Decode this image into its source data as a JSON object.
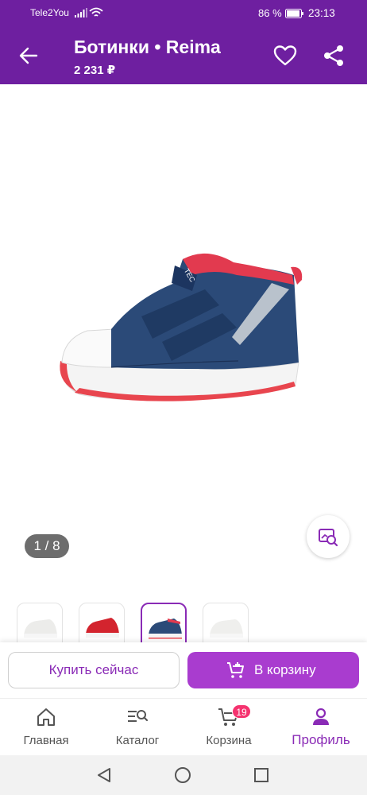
{
  "status_bar": {
    "carrier": "Tele2You",
    "battery": "86 %",
    "time": "23:13"
  },
  "header": {
    "title": "Ботинки • Reima",
    "price": "2 231 ₽",
    "icons": [
      "back-arrow-icon",
      "heart-icon",
      "share-icon"
    ]
  },
  "gallery": {
    "counter": "1 / 8",
    "find_similar_icon": "image-search-icon",
    "thumbnails": [
      {
        "name": "white-shoe",
        "active": false
      },
      {
        "name": "red-shoe",
        "active": false
      },
      {
        "name": "navy-shoe",
        "active": true
      },
      {
        "name": "white-shoe-2",
        "active": false
      }
    ]
  },
  "actions": {
    "buy_now": "Купить сейчас",
    "add_to_cart": "В корзину"
  },
  "bottom_nav": {
    "items": [
      {
        "label": "Главная",
        "icon": "home-icon"
      },
      {
        "label": "Каталог",
        "icon": "catalog-search-icon"
      },
      {
        "label": "Корзина",
        "icon": "cart-icon",
        "badge": "19"
      },
      {
        "label": "Профиль",
        "icon": "profile-icon",
        "active": true
      }
    ]
  },
  "colors": {
    "brand": "#6e1fa0",
    "accent": "#a93ccf",
    "badge": "#f5336f"
  }
}
